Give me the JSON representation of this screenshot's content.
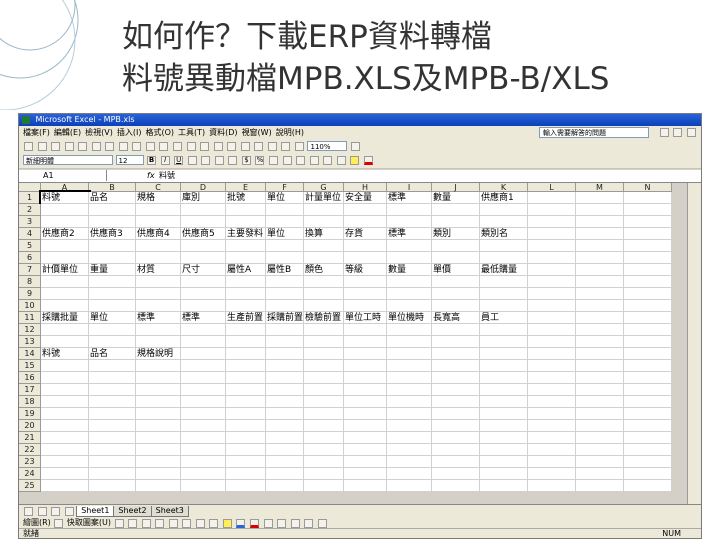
{
  "slide": {
    "title_line1": "如何作？下載ERP資料轉檔",
    "title_line2": "料號異動檔MPB.XLS及MPB-B/XLS"
  },
  "window": {
    "title": "Microsoft Excel - MPB.xls",
    "help_placeholder": "輸入需要解答的問題"
  },
  "menu": [
    "檔案(F)",
    "編輯(E)",
    "檢視(V)",
    "插入(I)",
    "格式(O)",
    "工具(T)",
    "資料(D)",
    "視窗(W)",
    "說明(H)"
  ],
  "toolbar": {
    "zoom": "110%",
    "font_name": "新細明體",
    "font_size": "12",
    "bold": "B",
    "italic": "I",
    "underline": "U",
    "currency": "$",
    "percent": "%"
  },
  "formula_bar": {
    "name_box": "A1",
    "fx": "fx",
    "value": "料號"
  },
  "columns": [
    "A",
    "B",
    "C",
    "D",
    "E",
    "F",
    "G",
    "H",
    "I",
    "J",
    "K",
    "L",
    "M",
    "N"
  ],
  "rows": [
    {
      "n": "1",
      "cells": [
        "料號",
        "品名",
        "規格",
        "庫別",
        "批號",
        "單位",
        "計量單位",
        "安全量",
        "標準",
        "數量",
        "供應商1"
      ]
    },
    {
      "n": "2",
      "cells": []
    },
    {
      "n": "3",
      "cells": []
    },
    {
      "n": "4",
      "cells": [
        "供應商2",
        "供應商3",
        "供應商4",
        "供應商5",
        "主要發料",
        "單位",
        "換算",
        "存貨",
        "標準",
        "類別",
        "類別名"
      ]
    },
    {
      "n": "5",
      "cells": []
    },
    {
      "n": "6",
      "cells": []
    },
    {
      "n": "7",
      "cells": [
        "計價單位",
        "重量",
        "材質",
        "尺寸",
        "屬性A",
        "屬性B",
        "顏色",
        "等級",
        "數量",
        "單價",
        "最低購量"
      ]
    },
    {
      "n": "8",
      "cells": []
    },
    {
      "n": "9",
      "cells": []
    },
    {
      "n": "10",
      "cells": []
    },
    {
      "n": "11",
      "cells": [
        "採購批量",
        "單位",
        "標準",
        "標準",
        "生產前置",
        "採購前置",
        "檢驗前置",
        "單位工時",
        "單位機時",
        "長寬高",
        "員工"
      ]
    },
    {
      "n": "12",
      "cells": []
    },
    {
      "n": "13",
      "cells": []
    },
    {
      "n": "14",
      "cells": [
        "料號",
        "品名",
        "規格說明"
      ]
    },
    {
      "n": "15",
      "cells": []
    },
    {
      "n": "16",
      "cells": []
    },
    {
      "n": "17",
      "cells": []
    },
    {
      "n": "18",
      "cells": []
    },
    {
      "n": "19",
      "cells": []
    },
    {
      "n": "20",
      "cells": []
    },
    {
      "n": "21",
      "cells": []
    },
    {
      "n": "22",
      "cells": []
    },
    {
      "n": "23",
      "cells": []
    },
    {
      "n": "24",
      "cells": []
    },
    {
      "n": "25",
      "cells": []
    }
  ],
  "sheets": [
    "Sheet1",
    "Sheet2",
    "Sheet3"
  ],
  "draw_toolbar": {
    "draw": "繪圖(R)",
    "autoshapes": "快取圖案(U)"
  },
  "status": {
    "left": "就緒",
    "right": "NUM"
  },
  "colors": {
    "titlebar": "#0a3fb8",
    "chrome": "#ece9d8",
    "deco": "#9ab7c9"
  }
}
